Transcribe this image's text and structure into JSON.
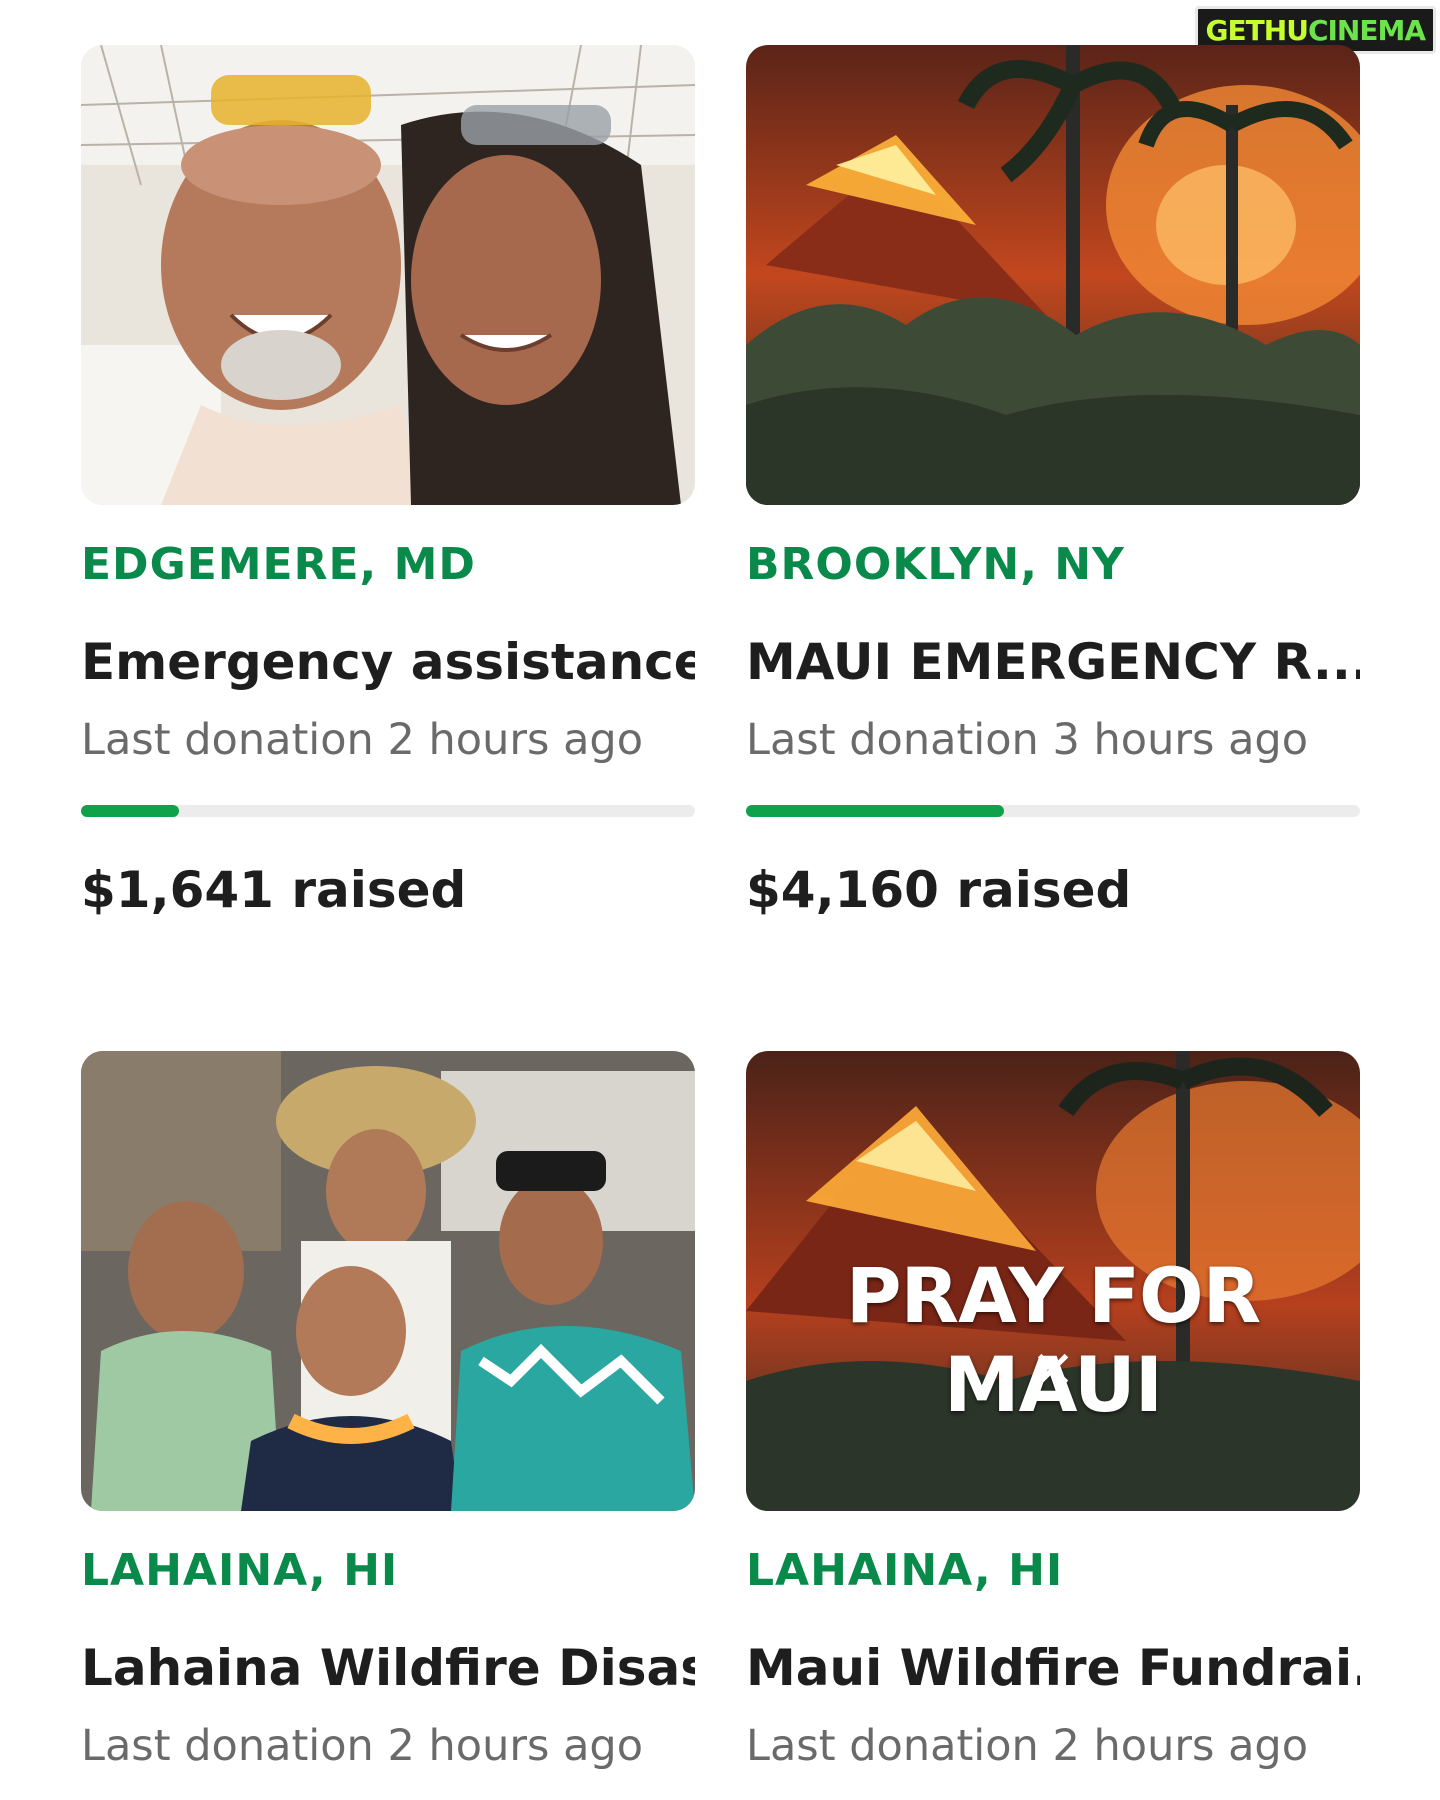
{
  "watermark": {
    "part1": "GETHU",
    "part2": "CINEMA"
  },
  "cards": [
    {
      "location": "EDGEMERE, MD",
      "title": "Emergency assistance...",
      "last_donation": "Last donation 2 hours ago",
      "progress_fraction": 0.16,
      "raised": "$1,641 raised"
    },
    {
      "location": "BROOKLYN, NY",
      "title": "MAUI EMERGENCY R...",
      "last_donation": "Last donation 3 hours ago",
      "progress_fraction": 0.42,
      "raised": "$4,160 raised"
    },
    {
      "location": "LAHAINA, HI",
      "title": "Lahaina Wildfire Disas...",
      "last_donation": "Last donation 2 hours ago"
    },
    {
      "location": "LAHAINA, HI",
      "title": "Maui Wildfire Fundrai...",
      "last_donation": "Last donation 2 hours ago",
      "image_text": "PRAY FOR MAUI",
      "image_mark": "✕"
    }
  ],
  "colors": {
    "location": "#0a8a4a",
    "progress_fill": "#0fa24a",
    "progress_track": "#ececec"
  }
}
